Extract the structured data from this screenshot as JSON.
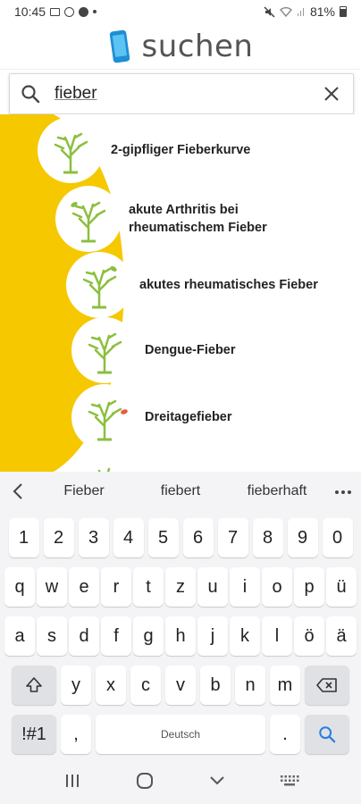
{
  "status": {
    "time": "10:45",
    "battery": "81%"
  },
  "header": {
    "title": "suchen"
  },
  "search": {
    "value": "fieber"
  },
  "results": [
    {
      "label_line1": "2-gipfliger Fieberkurve",
      "label_line2": ""
    },
    {
      "label_line1": "akute Arthritis bei",
      "label_line2": "rheumatischem Fieber"
    },
    {
      "label_line1": "akutes rheumatisches Fieber",
      "label_line2": ""
    },
    {
      "label_line1": "Dengue-Fieber",
      "label_line2": ""
    },
    {
      "label_line1": "Dreitagefieber",
      "label_line2": ""
    }
  ],
  "suggestions": [
    "Fieber",
    "fiebert",
    "fieberhaft"
  ],
  "keyboard": {
    "numbers": [
      "1",
      "2",
      "3",
      "4",
      "5",
      "6",
      "7",
      "8",
      "9",
      "0"
    ],
    "row1": [
      "q",
      "w",
      "e",
      "r",
      "t",
      "z",
      "u",
      "i",
      "o",
      "p",
      "ü"
    ],
    "row2": [
      "a",
      "s",
      "d",
      "f",
      "g",
      "h",
      "j",
      "k",
      "l",
      "ö",
      "ä"
    ],
    "row3": [
      "y",
      "x",
      "c",
      "v",
      "b",
      "n",
      "m"
    ],
    "symbols_label": "!#1",
    "comma": ",",
    "space_label": "Deutsch",
    "period": "."
  },
  "colors": {
    "accent_yellow": "#f5c800",
    "tree_green": "#8cbf3f",
    "search_blue": "#2a7de1"
  }
}
